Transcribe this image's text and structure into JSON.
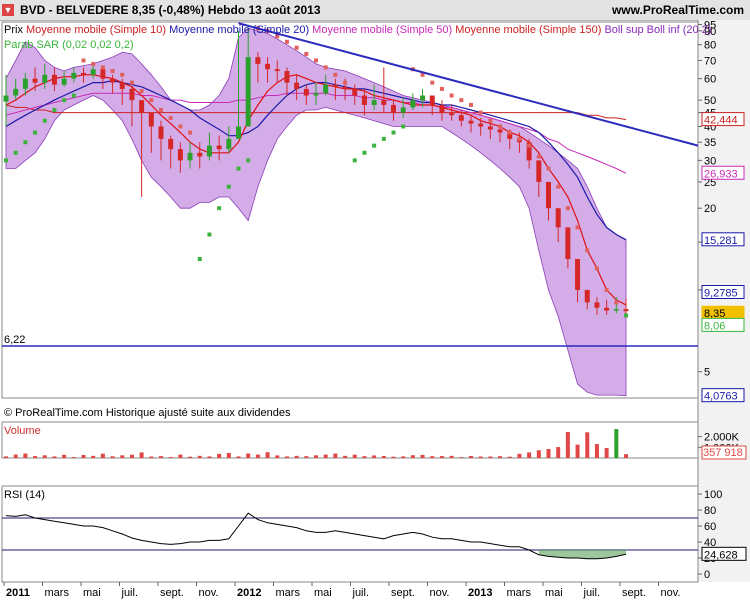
{
  "header": {
    "title": "BVD - BELVEDERE     8,35 (-0,48%)     Hebdo  13 août 2013",
    "site": "www.ProRealTime.com"
  },
  "legend": {
    "prix": "Prix",
    "ma10": "Moyenne mobile (Simple 10)",
    "ma20": "Moyenne mobile (Simple 20)",
    "ma50": "Moyenne mobile (Simple 50)",
    "ma150": "Moyenne mobile (Simple 150)",
    "boll": "Boll sup Boll inf (20 2)",
    "sar": "Parab SAR (0,02 0,02 0,2)"
  },
  "note": "© ProRealTime.com  Historique ajusté suite aux dividendes",
  "colors": {
    "up": "#2ca02c",
    "down": "#d62728",
    "ma10": "#e01010",
    "ma20": "#1a1aa8",
    "ma50": "#c82ab8",
    "ma150": "#cc2020",
    "boll_fill": "#b06ad6",
    "sar_up": "#3cb43c",
    "sar_down": "#e06060",
    "trendline": "#2b2bc0",
    "volume": "#e04848",
    "rsi": "#000000"
  },
  "chart_data": [
    {
      "type": "candlestick",
      "name": "price",
      "x_labels": [
        "2011",
        "mars",
        "mai",
        "juil.",
        "sept.",
        "nov.",
        "2012",
        "mars",
        "mai",
        "juil.",
        "sept.",
        "nov.",
        "2013",
        "mars",
        "mai",
        "juil.",
        "sept.",
        "nov."
      ],
      "y_ticks": [
        5,
        10,
        15,
        20,
        25,
        30,
        35,
        40,
        45,
        50,
        60,
        70,
        80,
        90,
        95
      ],
      "y_range": [
        4,
        97
      ],
      "y_scale": "log",
      "price_labels": [
        {
          "text": "42,444",
          "value": 42.4,
          "color": "#cc2020"
        },
        {
          "text": "26,933",
          "value": 26.9,
          "color": "#c82ab8"
        },
        {
          "text": "15,281",
          "value": 15.3,
          "color": "#1a1aa8"
        },
        {
          "text": "9,2785",
          "value": 9.3,
          "color": "#1a1aa8"
        },
        {
          "text": "8,35",
          "value": 8.35,
          "color": "#f0c000"
        },
        {
          "text": "8,06",
          "value": 8.06,
          "color": "#3cb43c"
        },
        {
          "text": "4,0763",
          "value": 4.08,
          "color": "#1a1aa8"
        }
      ],
      "horizontal_line": {
        "label": "6,22",
        "value": 6.22
      },
      "close": [
        52,
        55,
        60,
        58,
        62,
        57,
        60,
        63,
        62,
        65,
        60,
        58,
        55,
        50,
        45,
        40,
        36,
        33,
        30,
        32,
        31,
        34,
        33,
        36,
        40,
        72,
        68,
        65,
        64,
        58,
        55,
        52,
        53,
        57,
        56,
        55,
        52,
        48,
        50,
        48,
        45,
        47,
        50,
        52,
        48,
        45,
        44,
        42,
        41,
        40,
        39,
        38,
        36,
        35,
        30,
        25,
        20,
        17,
        13,
        10,
        9,
        8.6,
        8.4,
        8.5,
        8.35
      ],
      "high": [
        62,
        60,
        63,
        66,
        68,
        66,
        64,
        66,
        66,
        69,
        66,
        62,
        60,
        56,
        50,
        45,
        42,
        37,
        35,
        35,
        35,
        38,
        37,
        40,
        90,
        92,
        75,
        72,
        70,
        66,
        62,
        57,
        58,
        62,
        60,
        60,
        57,
        55,
        57,
        66,
        50,
        51,
        53,
        55,
        52,
        50,
        48,
        46,
        44,
        43,
        42,
        40,
        39,
        38,
        36,
        28,
        24,
        19,
        15,
        11,
        10,
        9.4,
        9.2,
        9.4,
        9.3
      ],
      "low": [
        40,
        50,
        52,
        54,
        55,
        54,
        56,
        58,
        58,
        60,
        55,
        53,
        48,
        40,
        22,
        32,
        30,
        28,
        27,
        28,
        28,
        30,
        30,
        32,
        38,
        52,
        58,
        58,
        58,
        52,
        50,
        48,
        48,
        52,
        50,
        50,
        48,
        44,
        46,
        45,
        42,
        43,
        46,
        47,
        44,
        42,
        42,
        40,
        38,
        37,
        36,
        35,
        33,
        32,
        28,
        22,
        18,
        15,
        12,
        9,
        8.5,
        8.1,
        8.1,
        8.2,
        8.1
      ],
      "ma10": [
        48,
        50,
        53,
        56,
        58,
        60,
        61,
        61,
        62,
        62,
        61,
        60,
        58,
        56,
        52,
        48,
        44,
        41,
        38,
        35,
        33,
        32,
        32,
        32,
        35,
        42,
        48,
        54,
        58,
        61,
        62,
        60,
        58,
        57,
        56,
        55,
        55,
        54,
        52,
        51,
        50,
        49,
        48,
        48,
        48,
        47,
        46,
        45,
        44,
        42,
        41,
        40,
        38,
        37,
        35,
        32,
        28,
        25,
        22,
        18,
        14,
        12,
        10,
        9.2,
        8.8
      ],
      "ma20": [
        40,
        42,
        44,
        46,
        48,
        50,
        52,
        54,
        56,
        58,
        58,
        59,
        58,
        57,
        56,
        54,
        52,
        50,
        48,
        46,
        43,
        41,
        39,
        37,
        37,
        38,
        40,
        44,
        48,
        52,
        55,
        57,
        58,
        58,
        57,
        56,
        55,
        55,
        54,
        53,
        52,
        51,
        50,
        49,
        49,
        48,
        48,
        47,
        46,
        45,
        44,
        43,
        42,
        41,
        40,
        38,
        35,
        32,
        29,
        26,
        22,
        19,
        17,
        16,
        15.3
      ],
      "ma50": [
        44,
        45,
        46,
        47,
        48,
        49,
        50,
        51,
        52,
        53,
        53,
        53,
        53,
        53,
        52,
        52,
        51,
        50,
        50,
        49,
        49,
        49,
        49,
        49,
        50,
        50,
        51,
        52,
        52,
        53,
        53,
        53,
        53,
        53,
        52,
        52,
        52,
        51,
        51,
        50,
        50,
        49,
        49,
        48,
        48,
        47,
        47,
        46,
        45,
        44,
        43,
        42,
        41,
        40,
        39,
        38,
        36,
        35,
        33,
        32,
        31,
        30,
        29,
        28,
        26.9
      ],
      "ma150": [
        48,
        47,
        47,
        46,
        46,
        45,
        45,
        45,
        45,
        45,
        45,
        45,
        45,
        45,
        45,
        45,
        45,
        45,
        45,
        45,
        45,
        45,
        45,
        45,
        45,
        45,
        45,
        45,
        45,
        45,
        45,
        45,
        45,
        45,
        45,
        45,
        45,
        45,
        45,
        45,
        45,
        45,
        45,
        45,
        45,
        45,
        45,
        45,
        45,
        45,
        45,
        45,
        45,
        45,
        45,
        45,
        45,
        45,
        45,
        45,
        44,
        44,
        43,
        43,
        42.4
      ],
      "boll_upper": [
        60,
        70,
        82,
        78,
        70,
        66,
        64,
        66,
        67,
        68,
        70,
        72,
        75,
        74,
        68,
        62,
        56,
        50,
        48,
        46,
        46,
        48,
        52,
        60,
        85,
        92,
        90,
        88,
        84,
        80,
        76,
        72,
        68,
        66,
        65,
        64,
        62,
        60,
        58,
        56,
        54,
        52,
        51,
        50,
        49,
        48,
        47,
        46,
        45,
        44,
        43,
        42,
        41,
        40,
        38,
        36,
        34,
        32,
        30,
        28,
        24,
        20,
        17,
        16,
        15.3
      ],
      "boll_lower": [
        28,
        28,
        30,
        32,
        36,
        42,
        46,
        48,
        50,
        52,
        50,
        46,
        42,
        36,
        30,
        26,
        24,
        22,
        20,
        20,
        21,
        21,
        22,
        22,
        20,
        18,
        24,
        30,
        36,
        40,
        44,
        46,
        46,
        47,
        46,
        45,
        44,
        43,
        42,
        41,
        40,
        40,
        40,
        40,
        40,
        40,
        38,
        36,
        34,
        32,
        30,
        28,
        26,
        24,
        20,
        14,
        10,
        8,
        6,
        4.5,
        4.2,
        4.1,
        4.1,
        4.1,
        4.08
      ],
      "sar": [
        30,
        32,
        35,
        38,
        42,
        46,
        50,
        52,
        70,
        68,
        66,
        64,
        62,
        58,
        54,
        50,
        46,
        43,
        40,
        38,
        13,
        16,
        20,
        24,
        28,
        30,
        92,
        90,
        86,
        82,
        78,
        74,
        70,
        66,
        62,
        58,
        30,
        32,
        34,
        36,
        38,
        40,
        65,
        62,
        58,
        55,
        52,
        50,
        48,
        45,
        42,
        40,
        38,
        36,
        34,
        31,
        28,
        24,
        20,
        17,
        14,
        12,
        10,
        9,
        8.06
      ],
      "trendline": {
        "from": [
          24,
          96
        ],
        "to": [
          64,
          40
        ]
      }
    },
    {
      "type": "bar",
      "name": "volume",
      "title": "Volume",
      "y_ticks": [
        "1.000K",
        "2.000K"
      ],
      "last_label": "357 918",
      "values_k": [
        150,
        320,
        420,
        180,
        250,
        150,
        300,
        90,
        280,
        200,
        400,
        160,
        250,
        300,
        520,
        140,
        180,
        90,
        320,
        120,
        200,
        150,
        380,
        470,
        150,
        420,
        320,
        540,
        240,
        150,
        200,
        170,
        250,
        320,
        420,
        200,
        310,
        170,
        240,
        190,
        120,
        150,
        260,
        290,
        170,
        180,
        200,
        80,
        190,
        140,
        140,
        170,
        120,
        390,
        520,
        720,
        840,
        1020,
        2420,
        1250,
        2400,
        1300,
        930,
        2700,
        357.9
      ]
    },
    {
      "type": "line",
      "name": "rsi",
      "title": "RSI (14)",
      "y_ticks": [
        0,
        20,
        40,
        60,
        80,
        100
      ],
      "levels": [
        30,
        70
      ],
      "last_label": "24,628",
      "values": [
        73,
        72,
        74,
        70,
        68,
        66,
        64,
        62,
        60,
        60,
        58,
        54,
        50,
        45,
        42,
        40,
        38,
        37,
        38,
        40,
        40,
        42,
        42,
        44,
        60,
        76,
        68,
        64,
        62,
        60,
        58,
        54,
        52,
        52,
        54,
        52,
        50,
        48,
        46,
        44,
        48,
        50,
        52,
        50,
        46,
        44,
        44,
        42,
        40,
        40,
        38,
        36,
        34,
        34,
        30,
        24,
        22,
        21,
        20,
        20,
        19,
        19,
        20,
        22,
        24.6
      ]
    }
  ]
}
